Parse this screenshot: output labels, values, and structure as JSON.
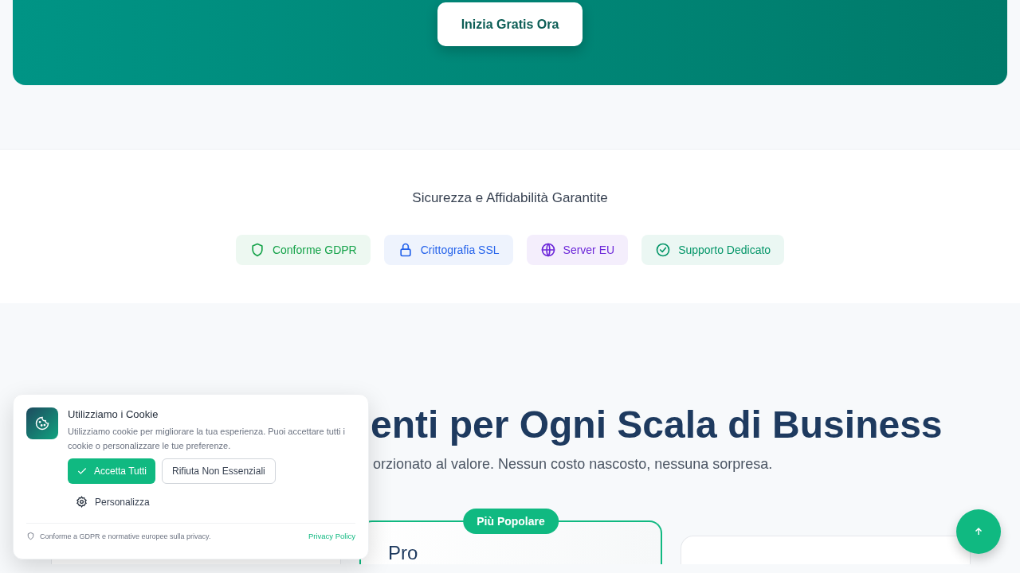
{
  "hero": {
    "cta": "Inizia Gratis Ora"
  },
  "trust": {
    "title": "Sicurezza e Affidabilità Garantite",
    "badges": [
      {
        "kind": "shield",
        "label": "Conforme GDPR",
        "color": "#16a34a"
      },
      {
        "kind": "lock",
        "label": "Crittografia SSL",
        "color": "#2563eb"
      },
      {
        "kind": "globe",
        "label": "Server EU",
        "color": "#6d28d9"
      },
      {
        "kind": "check",
        "label": "Supporto Dedicato",
        "color": "#059669"
      }
    ]
  },
  "pricing": {
    "title": "enti per Ogni Scala di Business",
    "subtitle": "orzionato al valore. Nessun costo nascosto, nessuna sorpresa.",
    "plans": [
      {
        "featured": false
      },
      {
        "featured": true,
        "badge": "Più Popolare",
        "name": "Pro"
      },
      {
        "featured": false
      }
    ]
  },
  "cookie_banner": {
    "title": "Utilizziamo i Cookie",
    "text": "Utilizziamo cookie per migliorare la tua esperienza. Puoi accettare tutti i cookie o personalizzare le tue preferenze.",
    "accept": "Accetta Tutti",
    "reject": "Rifiuta Non Essenziali",
    "customize": "Personalizza",
    "note": "Conforme a GDPR e normative europee sulla privacy.",
    "policy_link": "Privacy Policy"
  }
}
